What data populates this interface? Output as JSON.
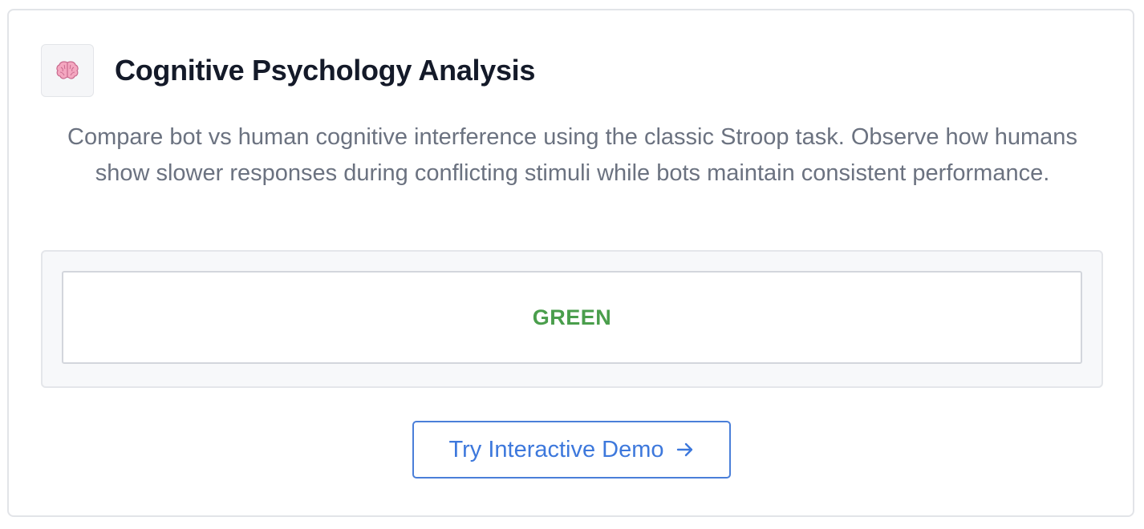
{
  "card": {
    "icon": "brain-icon",
    "title": "Cognitive Psychology Analysis",
    "description": "Compare bot vs human cognitive interference using the classic Stroop task. Observe how humans show slower responses during conflicting stimuli while bots maintain consistent performance."
  },
  "stimulus": {
    "word": "GREEN",
    "color": "#4a9e4c"
  },
  "cta": {
    "label": "Try Interactive Demo",
    "icon": "arrow-right-icon",
    "color": "#3d78dc"
  }
}
